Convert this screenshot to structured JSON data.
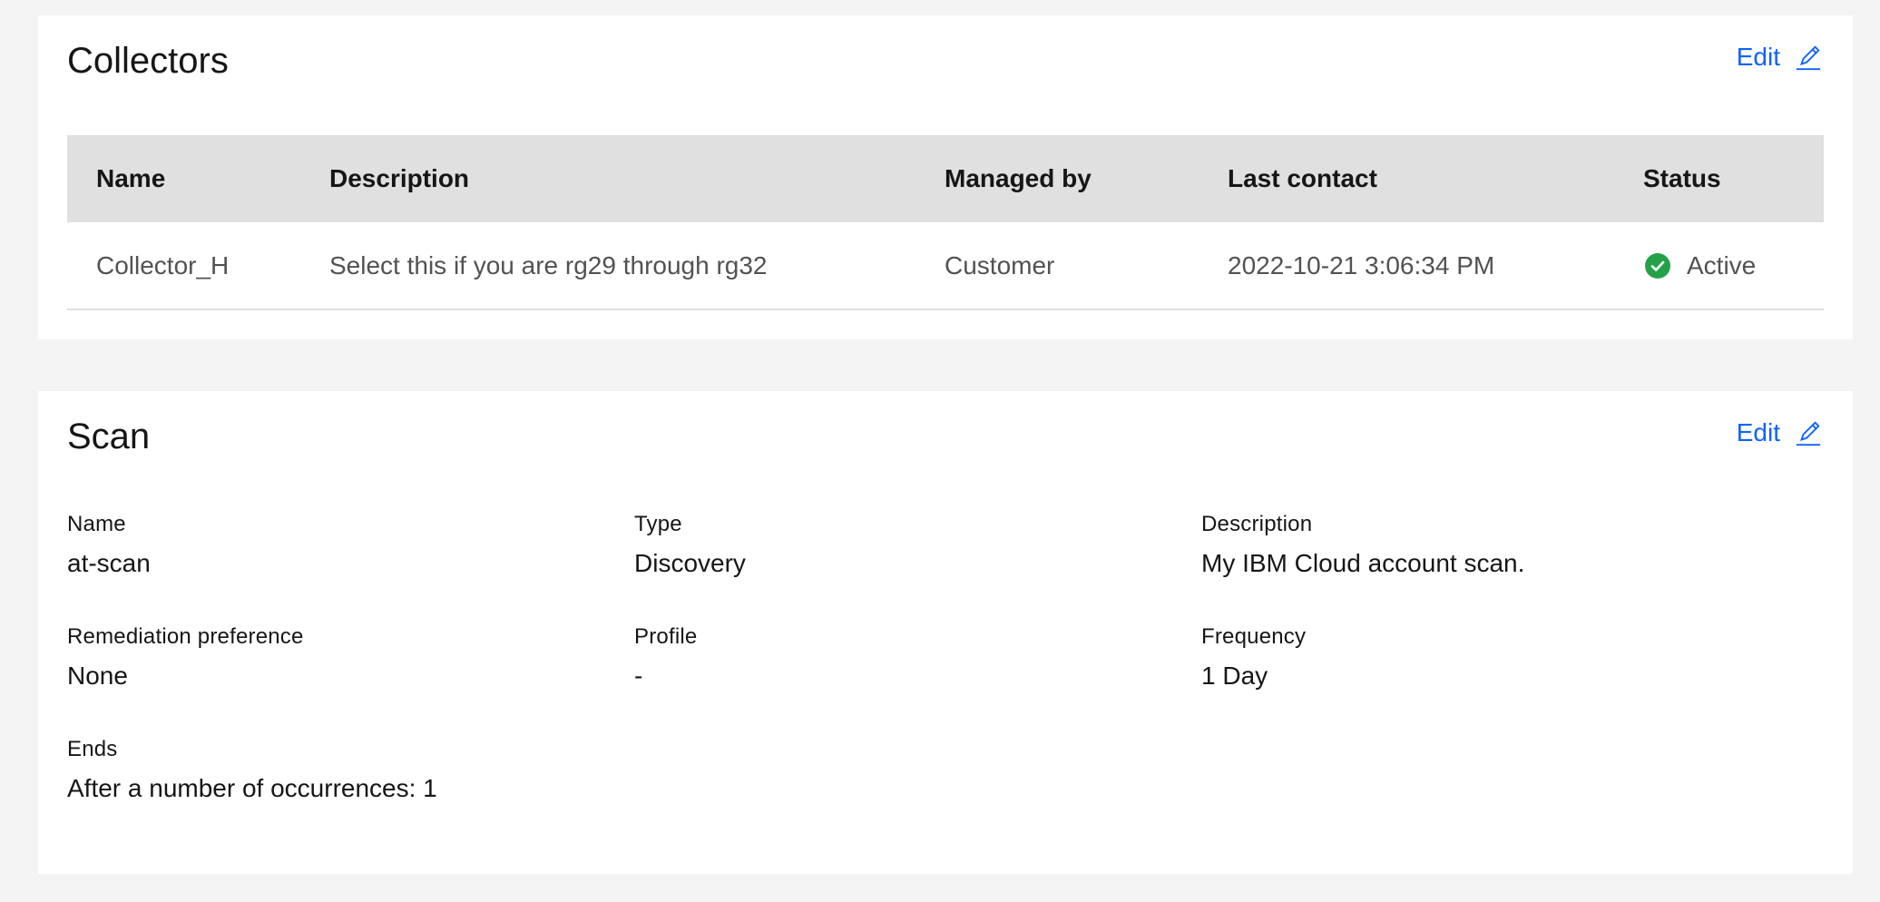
{
  "collectors": {
    "title": "Collectors",
    "edit_label": "Edit",
    "columns": [
      "Name",
      "Description",
      "Managed by",
      "Last contact",
      "Status"
    ],
    "rows": [
      {
        "name": "Collector_H",
        "description": "Select this if you are rg29 through rg32",
        "managed_by": "Customer",
        "last_contact": "2022-10-21 3:06:34 PM",
        "status": "Active",
        "status_icon": "checkmark-filled-icon",
        "status_color": "#24a148"
      }
    ]
  },
  "scan": {
    "title": "Scan",
    "edit_label": "Edit",
    "fields": [
      {
        "label": "Name",
        "value": "at-scan"
      },
      {
        "label": "Type",
        "value": "Discovery"
      },
      {
        "label": "Description",
        "value": "My IBM Cloud account scan."
      },
      {
        "label": "Remediation preference",
        "value": "None"
      },
      {
        "label": "Profile",
        "value": "-"
      },
      {
        "label": "Frequency",
        "value": "1 Day"
      },
      {
        "label": "Ends",
        "value": "After a number of occurrences: 1"
      }
    ]
  },
  "colors": {
    "link": "#0f62fe",
    "table_header_bg": "#e0e0e0",
    "page_bg": "#f4f4f4",
    "status_active": "#24a148"
  }
}
